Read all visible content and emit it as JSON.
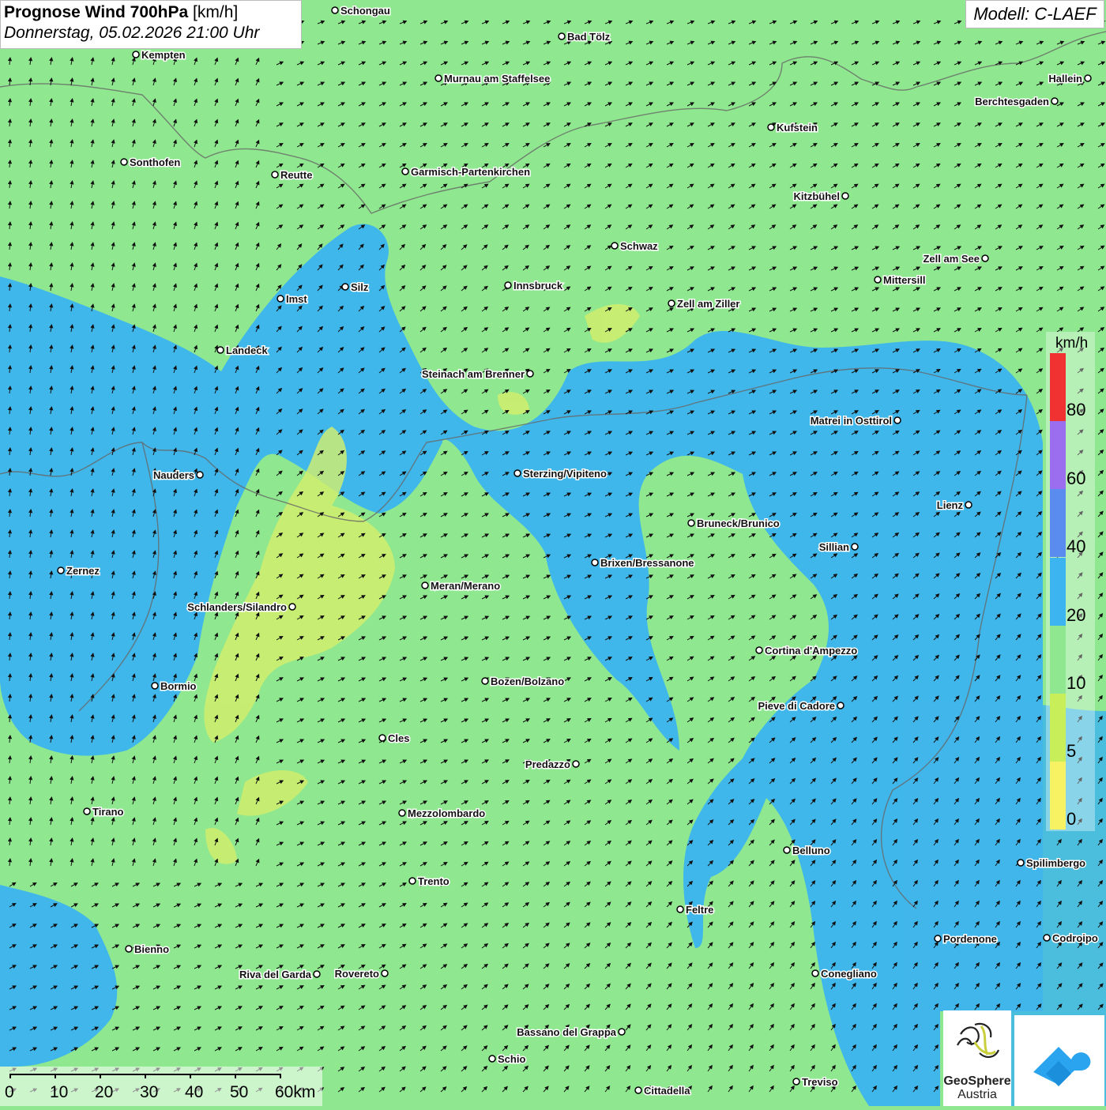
{
  "header": {
    "title_bold": "Prognose Wind 700hPa",
    "title_unit": " [km/h]",
    "date": "Donnerstag, 05.02.2026 21:00 Uhr",
    "model": "Modell: C-LAEF"
  },
  "legend": {
    "unit": "km/h",
    "labels": [
      "80",
      "60",
      "40",
      "20",
      "10",
      "5",
      "0"
    ],
    "colors": [
      "#f03232",
      "#9b6ef0",
      "#5a8cf0",
      "#3cb4f0",
      "#8fe88f",
      "#c8ee5a",
      "#f7f264"
    ]
  },
  "scalebar": {
    "labels": [
      "0",
      "10",
      "20",
      "30",
      "40",
      "50",
      "60km"
    ]
  },
  "logo": {
    "name": "GeoSphere",
    "sub": "Austria"
  },
  "cities": [
    {
      "name": "Schongau"
    },
    {
      "name": "Bad Tölz"
    },
    {
      "name": "Kempten"
    },
    {
      "name": "Murnau am Staffelsee"
    },
    {
      "name": "Hallein"
    },
    {
      "name": "Berchtesgaden"
    },
    {
      "name": "Kufstein"
    },
    {
      "name": "Sonthofen"
    },
    {
      "name": "Reutte"
    },
    {
      "name": "Garmisch-Partenkirchen"
    },
    {
      "name": "Kitzbühel"
    },
    {
      "name": "Schwaz"
    },
    {
      "name": "Zell am See"
    },
    {
      "name": "Mittersill"
    },
    {
      "name": "Innsbruck"
    },
    {
      "name": "Silz"
    },
    {
      "name": "Imst"
    },
    {
      "name": "Zell am Ziller"
    },
    {
      "name": "Landeck"
    },
    {
      "name": "Steinach am Brenner"
    },
    {
      "name": "Matrei in Osttirol"
    },
    {
      "name": "Nauders"
    },
    {
      "name": "Sterzing/Vipiteno"
    },
    {
      "name": "Lienz"
    },
    {
      "name": "Bruneck/Brunico"
    },
    {
      "name": "Sillian"
    },
    {
      "name": "Brixen/Bressanone"
    },
    {
      "name": "Zernez"
    },
    {
      "name": "Meran/Merano"
    },
    {
      "name": "Schlanders/Silandro"
    },
    {
      "name": "Cortina d'Ampezzo"
    },
    {
      "name": "Bozen/Bolzano"
    },
    {
      "name": "Bormio"
    },
    {
      "name": "Pieve di Cadore"
    },
    {
      "name": "Cles"
    },
    {
      "name": "Predazzo"
    },
    {
      "name": "Tirano"
    },
    {
      "name": "Mezzolombardo"
    },
    {
      "name": "Belluno"
    },
    {
      "name": "Spilimbergo"
    },
    {
      "name": "Trento"
    },
    {
      "name": "Feltre"
    },
    {
      "name": "Pordenone"
    },
    {
      "name": "Codroipo"
    },
    {
      "name": "Bienno"
    },
    {
      "name": "Riva del Garda"
    },
    {
      "name": "Rovereto"
    },
    {
      "name": "Conegliano"
    },
    {
      "name": "Bassano del Grappa"
    },
    {
      "name": "Schio"
    },
    {
      "name": "Treviso"
    },
    {
      "name": "Cittadella"
    }
  ]
}
